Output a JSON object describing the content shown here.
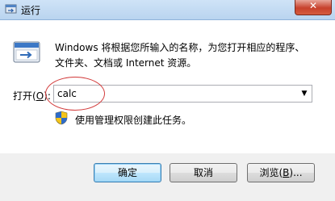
{
  "window": {
    "title": "运行",
    "close_glyph": "✕"
  },
  "dialog": {
    "description_line1": "Windows 将根据您所输入的名称，为您打开相应的程序、",
    "description_line2": "文件夹、文档或 Internet 资源。",
    "open_label_prefix": "打开(",
    "open_label_key": "O",
    "open_label_suffix": "):",
    "command_value": "calc",
    "admin_note": "使用管理权限创建此任务。"
  },
  "buttons": {
    "ok": "确定",
    "cancel": "取消",
    "browse_prefix": "浏览(",
    "browse_key": "B",
    "browse_suffix": ")..."
  },
  "icons": {
    "title": "run-icon",
    "main": "run-program-icon",
    "admin": "uac-shield-icon",
    "dropdown": "chevron-down-icon"
  },
  "colors": {
    "highlight_ellipse": "#d23b3b",
    "titlebar": "#cfe3f7",
    "close": "#c7412c"
  }
}
